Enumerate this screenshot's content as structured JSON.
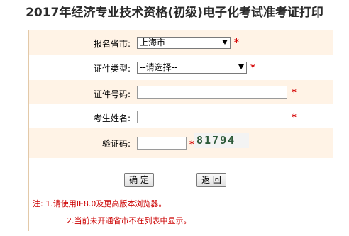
{
  "page": {
    "title": "2017年经济专业技术资格(初级)电子化考试准考证打印"
  },
  "form": {
    "province": {
      "label": "报名省市:",
      "value": "上海市",
      "required_mark": "*"
    },
    "cert_type": {
      "label": "证件类型:",
      "value": "--请选择--",
      "required_mark": "*"
    },
    "cert_number": {
      "label": "证件号码:",
      "value": "",
      "required_mark": "*"
    },
    "name": {
      "label": "考生姓名:",
      "value": "",
      "required_mark": "*"
    },
    "captcha": {
      "label": "验证码:",
      "value": "",
      "required_mark": "*",
      "image_text": "81794"
    }
  },
  "buttons": {
    "confirm": "确 定",
    "back": "返 回"
  },
  "notes": {
    "line1": "注: 1.请使用IE8.0及更高版本浏览器。",
    "line2": "2.当前未开通省市不在列表中显示。"
  },
  "colors": {
    "row_alt_bg": "#fff3e6",
    "required": "#d40000",
    "note_text": "#cc0000"
  }
}
